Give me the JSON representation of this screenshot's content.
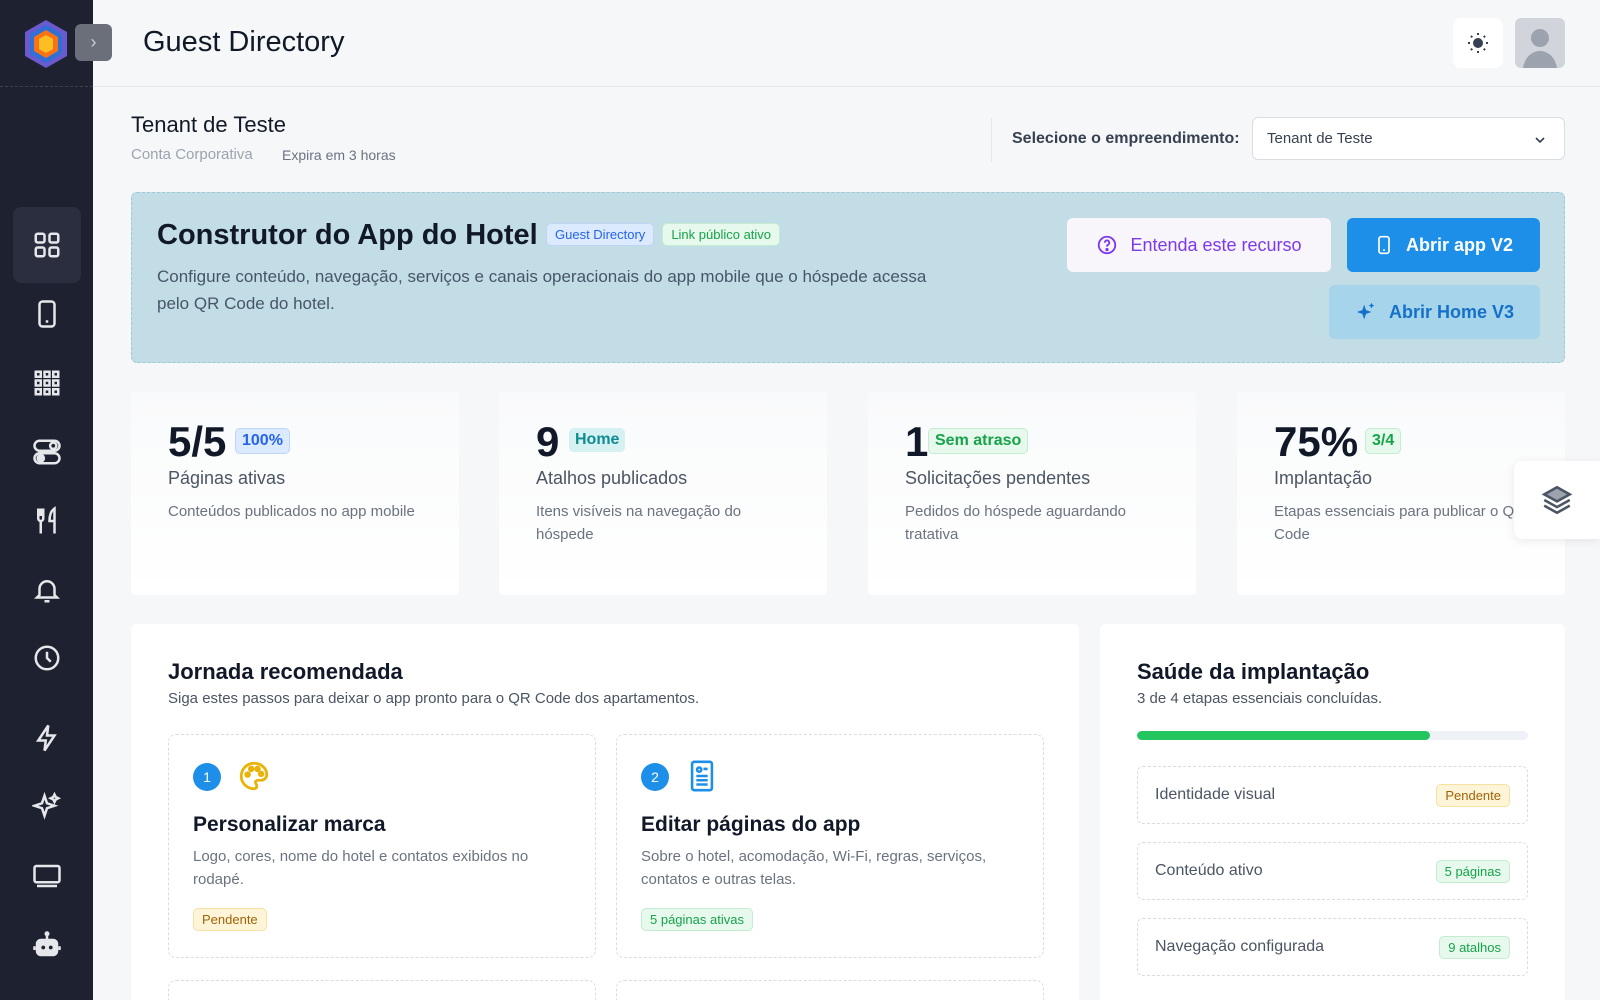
{
  "header": {
    "title": "Guest Directory"
  },
  "tenant": {
    "name": "Tenant de Teste",
    "type": "Conta Corporativa",
    "expiry": "Expira em 3 horas",
    "select_label": "Selecione o empreendimento:",
    "select_value": "Tenant de Teste"
  },
  "hero": {
    "title": "Construtor do App do Hotel",
    "badge_module": "Guest Directory",
    "badge_link": "Link público ativo",
    "description": "Configure conteúdo, navegação, serviços e canais operacionais do app mobile que o hóspede acessa pelo QR Code do hotel.",
    "btn_understand": "Entenda este recurso",
    "btn_open_v2": "Abrir app V2",
    "btn_open_v3": "Abrir Home V3"
  },
  "stats": [
    {
      "value": "5/5",
      "badge": "100%",
      "title": "Páginas ativas",
      "desc": "Conteúdos publicados no app mobile"
    },
    {
      "value": "9",
      "badge": "Home",
      "title": "Atalhos publicados",
      "desc": "Itens visíveis na navegação do hóspede"
    },
    {
      "value": "1",
      "badge": "Sem atraso",
      "title": "Solicitações pendentes",
      "desc": "Pedidos do hóspede aguardando tratativa"
    },
    {
      "value": "75%",
      "badge": "3/4",
      "title": "Implantação",
      "desc": "Etapas essenciais para publicar o QR Code"
    }
  ],
  "journey": {
    "title": "Jornada recomendada",
    "subtitle": "Siga estes passos para deixar o app pronto para o QR Code dos apartamentos.",
    "steps": [
      {
        "number": "1",
        "title": "Personalizar marca",
        "desc": "Logo, cores, nome do hotel e contatos exibidos no rodapé.",
        "badge": "Pendente"
      },
      {
        "number": "2",
        "title": "Editar páginas do app",
        "desc": "Sobre o hotel, acomodação, Wi-Fi, regras, serviços, contatos e outras telas.",
        "badge": "5 páginas ativas"
      }
    ]
  },
  "health": {
    "title": "Saúde da implantação",
    "subtitle": "3 de 4 etapas essenciais concluídas.",
    "progress": 0.75,
    "rows": [
      {
        "label": "Identidade visual",
        "badge": "Pendente"
      },
      {
        "label": "Conteúdo ativo",
        "badge": "5 páginas"
      },
      {
        "label": "Navegação configurada",
        "badge": "9 atalhos"
      }
    ]
  },
  "icons": {
    "sidebar": [
      "dashboard-icon",
      "phone-icon",
      "apps-grid-icon",
      "toggles-icon",
      "utensils-icon",
      "bell-icon",
      "clock-icon",
      "lightning-icon",
      "sparkles-icon",
      "monitor-icon",
      "robot-icon"
    ],
    "floating": "layers-icon"
  },
  "colors": {
    "primary": "#1d8fe8",
    "sidebar": "#1e2130",
    "hero_bg": "#c2dde5",
    "success": "#22c55e"
  }
}
